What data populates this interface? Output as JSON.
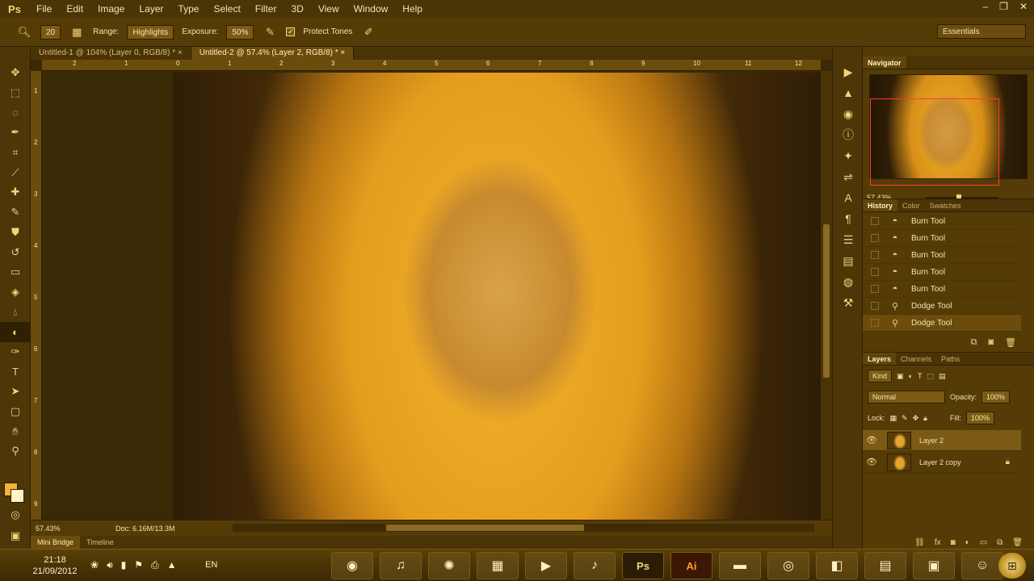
{
  "app": {
    "logo": "Ps",
    "menu": [
      "File",
      "Edit",
      "Image",
      "Layer",
      "Type",
      "Select",
      "Filter",
      "3D",
      "View",
      "Window",
      "Help"
    ],
    "window_controls": [
      "–",
      "❐",
      "✕"
    ]
  },
  "options": {
    "brush_size": "20",
    "range_label": "Range:",
    "range_value": "Highlights",
    "exposure_label": "Exposure:",
    "exposure_value": "50%",
    "protect_tones_label": "Protect Tones",
    "protect_tones_checked": true,
    "workspace": "Essentials"
  },
  "documents": {
    "tabs": [
      {
        "label": "Untitled-1 @ 104% (Layer 0, RGB/8) *",
        "close": "×"
      },
      {
        "label": "Untitled-2 @ 57.4% (Layer 2, RGB/8) *",
        "close": "×"
      }
    ]
  },
  "ruler": {
    "top": [
      "2",
      "1",
      "0",
      "1",
      "2",
      "3",
      "4",
      "5",
      "6",
      "7",
      "8",
      "9",
      "10",
      "11",
      "12"
    ],
    "left": [
      "1",
      "2",
      "3",
      "4",
      "5",
      "6",
      "7",
      "8",
      "9"
    ]
  },
  "status": {
    "zoom": "57.43%",
    "doc": "Doc: 6.16M/13.3M"
  },
  "minibridge": {
    "tabs": [
      "Mini Bridge",
      "Timeline"
    ]
  },
  "navigator": {
    "title": "Navigator",
    "zoom": "57.43%"
  },
  "history": {
    "tabs": [
      "History",
      "Color",
      "Swatches"
    ],
    "items": [
      {
        "label": "Burn Tool",
        "icon": "burn-icon"
      },
      {
        "label": "Burn Tool",
        "icon": "burn-icon"
      },
      {
        "label": "Burn Tool",
        "icon": "burn-icon"
      },
      {
        "label": "Burn Tool",
        "icon": "burn-icon"
      },
      {
        "label": "Burn Tool",
        "icon": "burn-icon"
      },
      {
        "label": "Dodge Tool",
        "icon": "dodge-icon"
      },
      {
        "label": "Dodge Tool",
        "icon": "dodge-icon"
      }
    ]
  },
  "layers": {
    "tabs": [
      "Layers",
      "Channels",
      "Paths"
    ],
    "kind": "Kind",
    "blend_mode": "Normal",
    "opacity_label": "Opacity:",
    "opacity_value": "100%",
    "lock_label": "Lock:",
    "fill_label": "Fill:",
    "fill_value": "100%",
    "items": [
      {
        "name": "Layer 2",
        "locked": false
      },
      {
        "name": "Layer 2 copy",
        "locked": true
      }
    ]
  },
  "taskbar": {
    "time": "21:18",
    "date": "21/09/2012",
    "language": "EN",
    "apps": [
      "Ps",
      "Ai"
    ]
  },
  "colors": {
    "accent": "#f3d37a",
    "background": "#553c07",
    "foreground_swatch": "#f3b43a",
    "background_swatch": "#fff1c8",
    "navigator_frame": "#ff3a2e"
  }
}
